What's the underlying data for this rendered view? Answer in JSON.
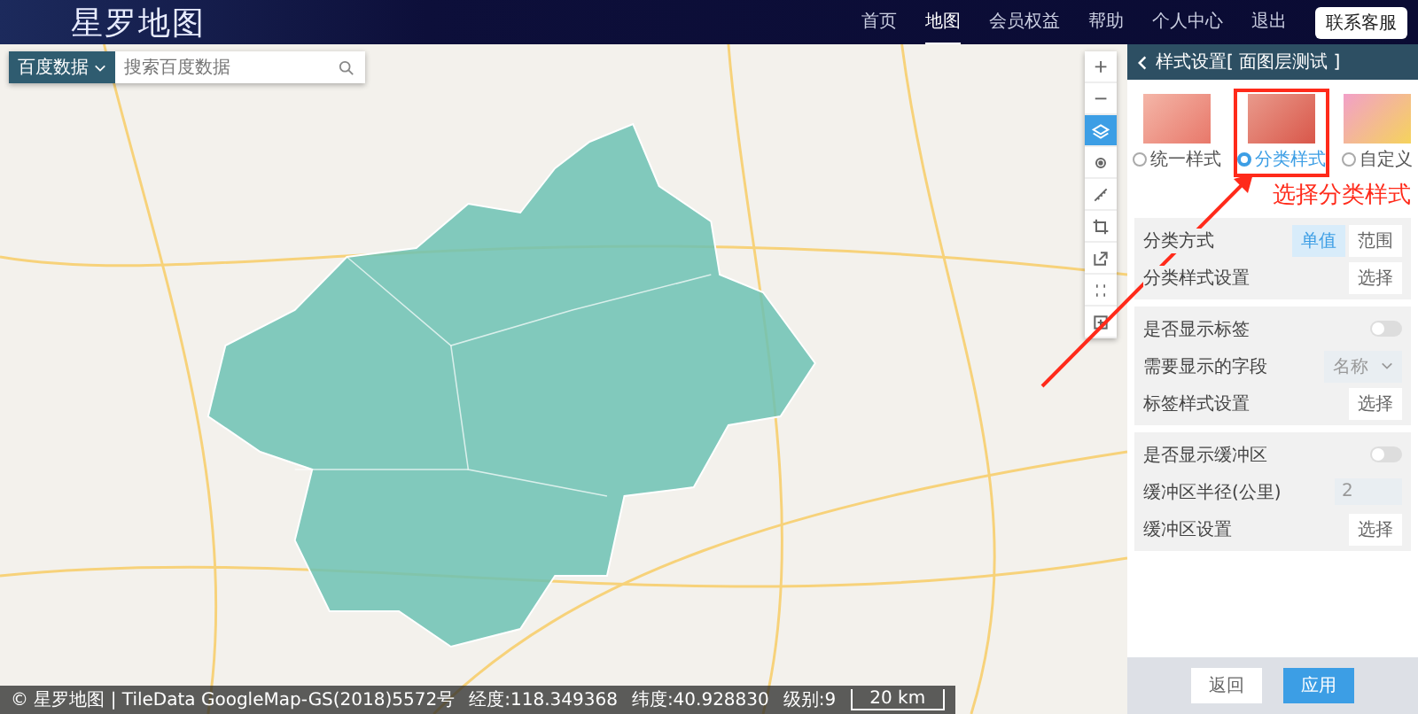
{
  "header": {
    "logo": "星罗地图",
    "nav": [
      {
        "label": "首页",
        "selected": false
      },
      {
        "label": "地图",
        "selected": true
      },
      {
        "label": "会员权益",
        "selected": false
      },
      {
        "label": "帮助",
        "selected": false
      },
      {
        "label": "个人中心",
        "selected": false
      },
      {
        "label": "退出",
        "selected": false
      }
    ],
    "contact_button": "联系客服"
  },
  "search": {
    "source": "百度数据",
    "placeholder": "搜索百度数据"
  },
  "map_tools": [
    {
      "kind": "zoom-in",
      "symbol": "+",
      "selected": false
    },
    {
      "kind": "zoom-out",
      "symbol": "−",
      "selected": false
    },
    {
      "kind": "layers",
      "selected": true
    },
    {
      "kind": "target",
      "selected": false
    },
    {
      "kind": "ruler",
      "selected": false
    },
    {
      "kind": "crop",
      "selected": false
    },
    {
      "kind": "export",
      "selected": false
    },
    {
      "kind": "grid",
      "selected": false
    },
    {
      "kind": "frame",
      "selected": false
    }
  ],
  "status_bar": {
    "copyright": "© 星罗地图 | TileData GoogleMap-GS(2018)5572号",
    "longitude": "经度:118.349368",
    "latitude": "纬度:40.928830",
    "zoom": "级别:9",
    "scale": "20 km"
  },
  "panel": {
    "title": "样式设置[ 面图层测试 ]",
    "styles": [
      {
        "label": "统一样式",
        "kind": "uniform",
        "selected": false,
        "highlighted": false
      },
      {
        "label": "分类样式",
        "kind": "category",
        "selected": true,
        "highlighted": true
      },
      {
        "label": "自定义",
        "kind": "custom",
        "selected": false,
        "highlighted": false
      }
    ],
    "groups": [
      [
        {
          "label": "分类方式",
          "kind": "segmented",
          "options": [
            {
              "label": "单值",
              "selected": true
            },
            {
              "label": "范围",
              "selected": false
            }
          ]
        },
        {
          "label": "分类样式设置",
          "kind": "button",
          "button": "选择"
        }
      ],
      [
        {
          "label": "是否显示标签",
          "kind": "toggle",
          "on": false
        },
        {
          "label": "需要显示的字段",
          "kind": "select",
          "value": "名称"
        },
        {
          "label": "标签样式设置",
          "kind": "button",
          "button": "选择"
        }
      ],
      [
        {
          "label": "是否显示缓冲区",
          "kind": "toggle",
          "on": false
        },
        {
          "label": "缓冲区半径(公里)",
          "kind": "input",
          "value": "2"
        },
        {
          "label": "缓冲区设置",
          "kind": "button",
          "button": "选择"
        }
      ]
    ],
    "footer_buttons": [
      {
        "label": "返回",
        "kind": "secondary"
      },
      {
        "label": "应用",
        "kind": "primary"
      }
    ]
  },
  "annotation": {
    "text": "选择分类样式"
  }
}
